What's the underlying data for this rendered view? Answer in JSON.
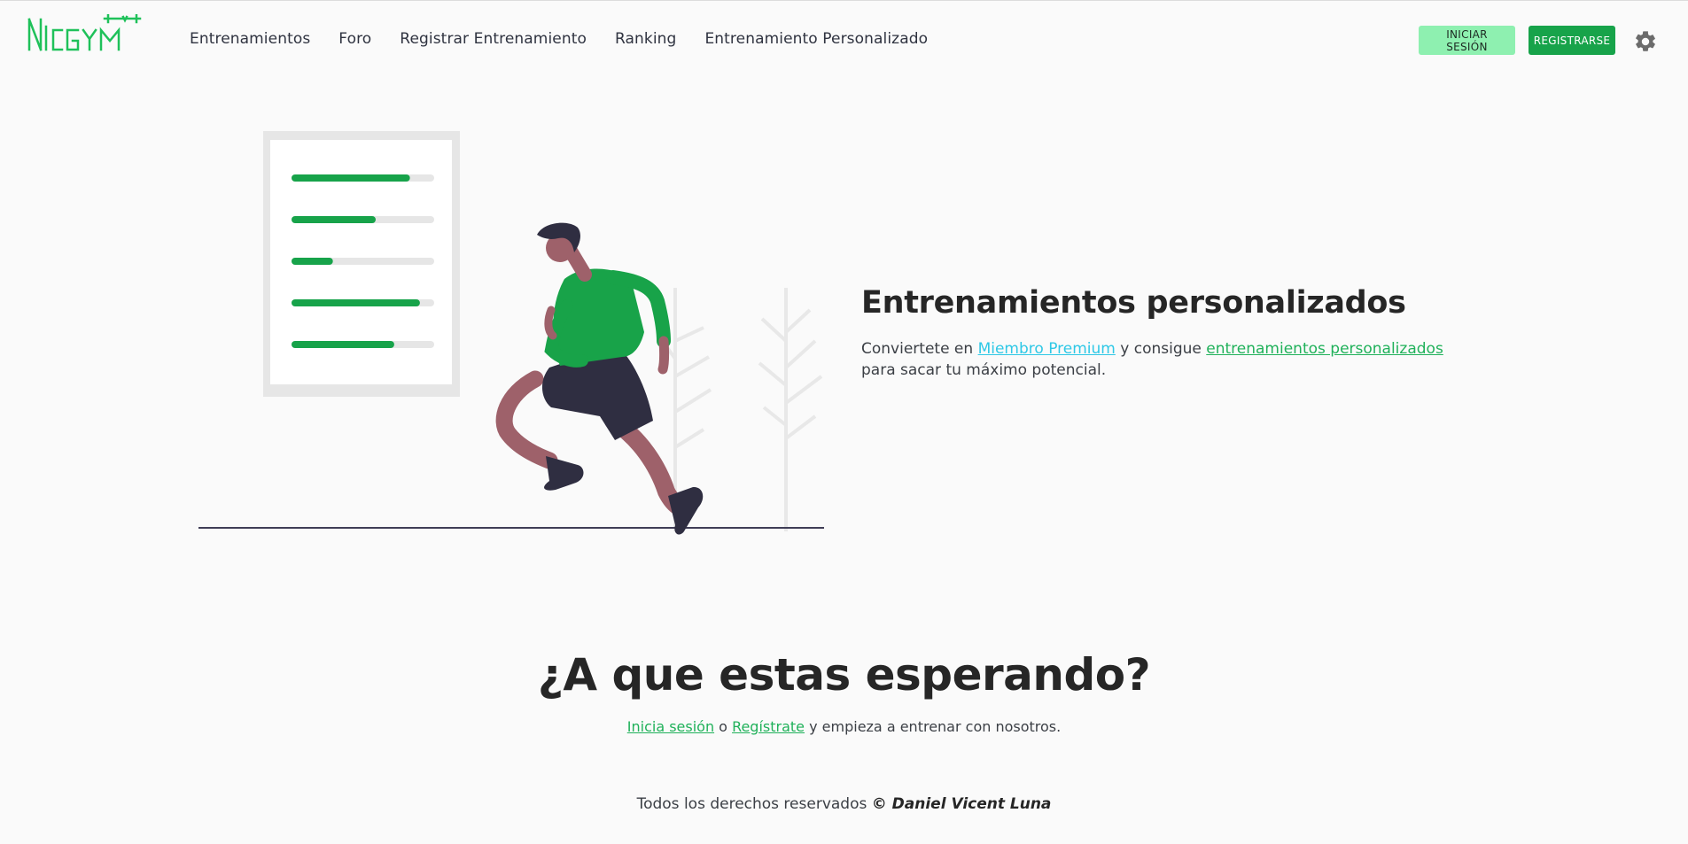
{
  "brand": {
    "logo_text": "NICGYM",
    "accent": "#17a34a",
    "accent_light": "#8ef0b0",
    "link_cyan": "#2ec8e6"
  },
  "nav": {
    "items": [
      {
        "label": "Entrenamientos"
      },
      {
        "label": "Foro"
      },
      {
        "label": "Registrar Entrenamiento"
      },
      {
        "label": "Ranking"
      },
      {
        "label": "Entrenamiento Personalizado"
      }
    ]
  },
  "header": {
    "login_label": "INICIAR SESIÓN",
    "register_label": "REGISTRARSE",
    "settings_icon": "gear-icon"
  },
  "hero": {
    "title": "Entrenamientos personalizados",
    "desc_part1": "Conviertete en ",
    "link_premium": "Miembro Premium",
    "desc_part2": " y consigue ",
    "link_custom": "entrenamientos personalizados",
    "desc_part3": " para sacar tu máximo potencial.",
    "illustration": "runner-and-checklist",
    "checklist_progress": [
      0.83,
      0.59,
      0.29,
      0.9,
      0.72
    ]
  },
  "cta": {
    "title": "¿A que estas esperando?",
    "link_login": "Inicia sesión",
    "connector": " o ",
    "link_register": "Regístrate",
    "tail": " y empieza a entrenar con nosotros."
  },
  "footer": {
    "text": "Todos los derechos reservados ",
    "author": "© Daniel Vicent Luna"
  }
}
